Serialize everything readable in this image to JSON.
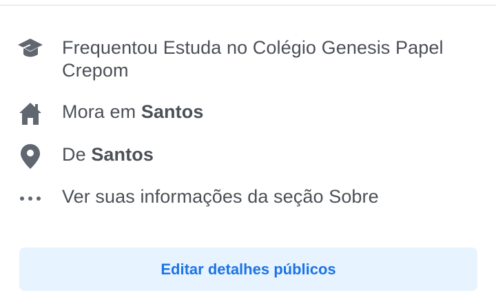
{
  "intro": {
    "education": {
      "icon": "graduation-cap-icon",
      "text": "Frequentou Estuda no Colégio Genesis Papel Crepom"
    },
    "lives_in": {
      "icon": "home-icon",
      "prefix": "Mora em ",
      "place": "Santos"
    },
    "from": {
      "icon": "location-pin-icon",
      "prefix": "De ",
      "place": "Santos"
    },
    "about": {
      "icon": "more-dots-icon",
      "text": "Ver suas informações da seção Sobre"
    }
  },
  "actions": {
    "edit_label": "Editar detalhes públicos"
  },
  "colors": {
    "icon": "#606770",
    "text": "#4b4f56",
    "button_bg": "#e7f3ff",
    "button_text": "#1b74e4"
  }
}
